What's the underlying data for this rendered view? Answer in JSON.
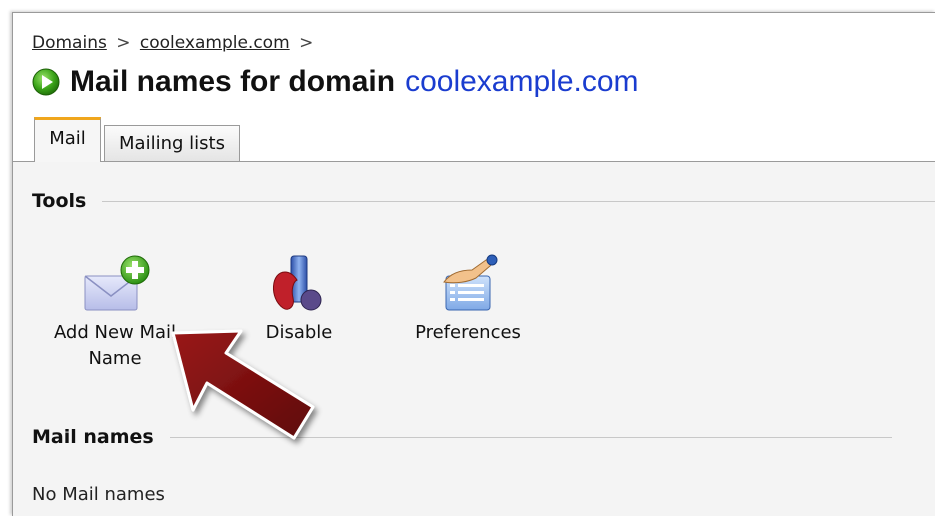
{
  "breadcrumb": {
    "items": [
      "Domains",
      "coolexample.com"
    ],
    "separator": ">"
  },
  "title": {
    "prefix": "Mail names for domain",
    "domain": "coolexample.com"
  },
  "tabs": [
    {
      "label": "Mail",
      "active": true
    },
    {
      "label": "Mailing lists",
      "active": false
    }
  ],
  "tools": {
    "heading": "Tools",
    "items": [
      {
        "label": "Add New Mail Name",
        "icon": "add-mail-icon"
      },
      {
        "label": "Disable",
        "icon": "disable-icon"
      },
      {
        "label": "Preferences",
        "icon": "preferences-icon"
      }
    ]
  },
  "mail_names": {
    "heading": "Mail names",
    "empty_text": "No Mail names"
  },
  "colors": {
    "link_blue": "#1a3ccf",
    "tab_accent": "#f0a61c",
    "arrow": "#7a0c0c",
    "play_green": "#3aa318"
  }
}
